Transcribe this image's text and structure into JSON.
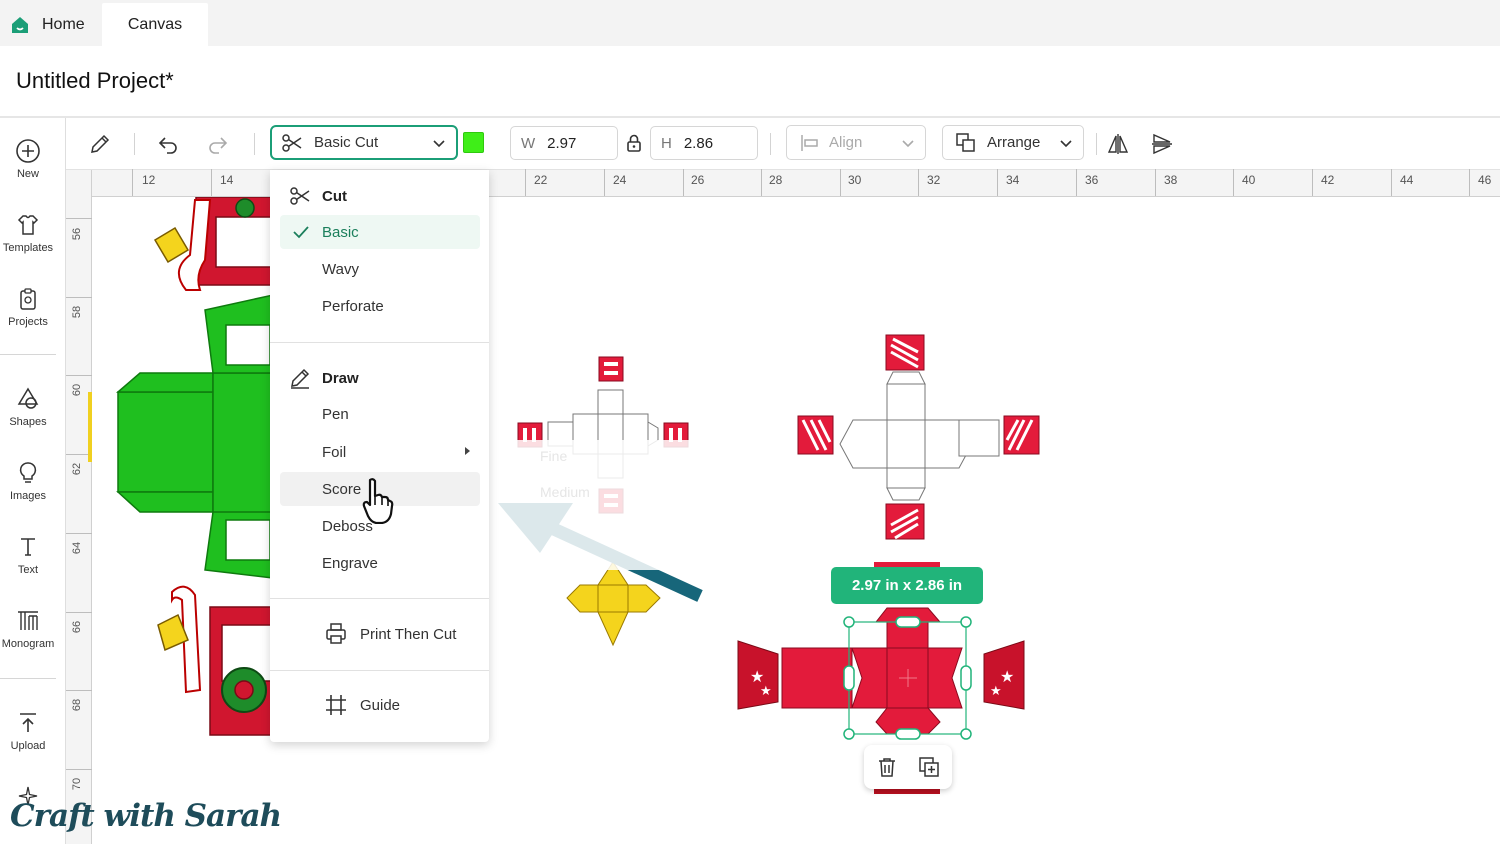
{
  "tabs": [
    {
      "label": "Home"
    },
    {
      "label": "Canvas"
    }
  ],
  "project": {
    "title": "Untitled Project*"
  },
  "rail": {
    "items": [
      {
        "label": "New",
        "icon": "plus-circle-icon"
      },
      {
        "label": "Templates",
        "icon": "shirt-icon"
      },
      {
        "label": "Projects",
        "icon": "clipboard-icon"
      },
      {
        "label": "Shapes",
        "icon": "shapes-icon"
      },
      {
        "label": "Images",
        "icon": "lightbulb-icon"
      },
      {
        "label": "Text",
        "icon": "text-icon"
      },
      {
        "label": "Monogram",
        "icon": "monogram-icon"
      },
      {
        "label": "Upload",
        "icon": "upload-icon"
      }
    ]
  },
  "toolbar": {
    "operation": "Basic Cut",
    "color": "#3fee18",
    "width_key": "W",
    "width_value": "2.97",
    "height_key": "H",
    "height_value": "2.86",
    "align_label": "Align",
    "arrange_label": "Arrange"
  },
  "ruler": {
    "top": [
      "12",
      "14",
      "22",
      "24",
      "26",
      "28",
      "30",
      "32",
      "34",
      "36",
      "38",
      "40",
      "42",
      "44",
      "46"
    ],
    "left": [
      "56",
      "58",
      "60",
      "62",
      "64",
      "66",
      "68",
      "70"
    ]
  },
  "menu": {
    "cut_heading": "Cut",
    "cut_items": [
      "Basic",
      "Wavy",
      "Perforate"
    ],
    "draw_heading": "Draw",
    "draw_items": [
      "Pen",
      "Foil",
      "Score",
      "Deboss",
      "Engrave"
    ],
    "print_then_cut": "Print Then Cut",
    "guide": "Guide"
  },
  "ghost": {
    "fine": "Fine",
    "medium": "Medium"
  },
  "selection": {
    "size_label": "2.97  in x 2.86  in"
  },
  "colors": {
    "accent": "#1b9e77",
    "badge": "#21b47a",
    "red": "#e31b3b",
    "green": "#1fbf1f",
    "yellow": "#f4d41d",
    "arrow": "#17667a"
  },
  "watermark": "Craft with Sarah"
}
